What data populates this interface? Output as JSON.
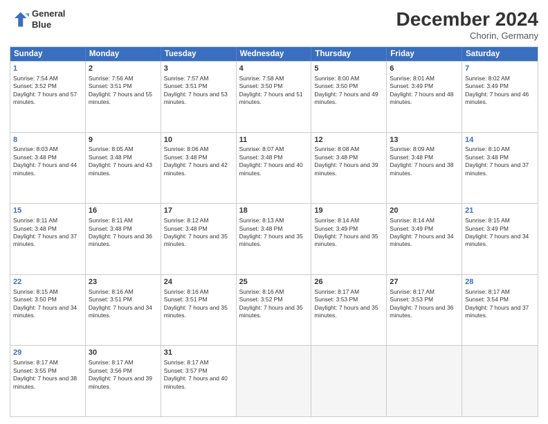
{
  "header": {
    "logo_line1": "General",
    "logo_line2": "Blue",
    "month": "December 2024",
    "location": "Chorin, Germany"
  },
  "days_of_week": [
    "Sunday",
    "Monday",
    "Tuesday",
    "Wednesday",
    "Thursday",
    "Friday",
    "Saturday"
  ],
  "weeks": [
    [
      {
        "day": 1,
        "sunrise": "7:54 AM",
        "sunset": "3:52 PM",
        "daylight": "7 hours and 57 minutes.",
        "dow": "sunday"
      },
      {
        "day": 2,
        "sunrise": "7:56 AM",
        "sunset": "3:51 PM",
        "daylight": "7 hours and 55 minutes.",
        "dow": "monday"
      },
      {
        "day": 3,
        "sunrise": "7:57 AM",
        "sunset": "3:51 PM",
        "daylight": "7 hours and 53 minutes.",
        "dow": "tuesday"
      },
      {
        "day": 4,
        "sunrise": "7:58 AM",
        "sunset": "3:50 PM",
        "daylight": "7 hours and 51 minutes.",
        "dow": "wednesday"
      },
      {
        "day": 5,
        "sunrise": "8:00 AM",
        "sunset": "3:50 PM",
        "daylight": "7 hours and 49 minutes.",
        "dow": "thursday"
      },
      {
        "day": 6,
        "sunrise": "8:01 AM",
        "sunset": "3:49 PM",
        "daylight": "7 hours and 48 minutes.",
        "dow": "friday"
      },
      {
        "day": 7,
        "sunrise": "8:02 AM",
        "sunset": "3:49 PM",
        "daylight": "7 hours and 46 minutes.",
        "dow": "saturday"
      }
    ],
    [
      {
        "day": 8,
        "sunrise": "8:03 AM",
        "sunset": "3:48 PM",
        "daylight": "7 hours and 44 minutes.",
        "dow": "sunday"
      },
      {
        "day": 9,
        "sunrise": "8:05 AM",
        "sunset": "3:48 PM",
        "daylight": "7 hours and 43 minutes.",
        "dow": "monday"
      },
      {
        "day": 10,
        "sunrise": "8:06 AM",
        "sunset": "3:48 PM",
        "daylight": "7 hours and 42 minutes.",
        "dow": "tuesday"
      },
      {
        "day": 11,
        "sunrise": "8:07 AM",
        "sunset": "3:48 PM",
        "daylight": "7 hours and 40 minutes.",
        "dow": "wednesday"
      },
      {
        "day": 12,
        "sunrise": "8:08 AM",
        "sunset": "3:48 PM",
        "daylight": "7 hours and 39 minutes.",
        "dow": "thursday"
      },
      {
        "day": 13,
        "sunrise": "8:09 AM",
        "sunset": "3:48 PM",
        "daylight": "7 hours and 38 minutes.",
        "dow": "friday"
      },
      {
        "day": 14,
        "sunrise": "8:10 AM",
        "sunset": "3:48 PM",
        "daylight": "7 hours and 37 minutes.",
        "dow": "saturday"
      }
    ],
    [
      {
        "day": 15,
        "sunrise": "8:11 AM",
        "sunset": "3:48 PM",
        "daylight": "7 hours and 37 minutes.",
        "dow": "sunday"
      },
      {
        "day": 16,
        "sunrise": "8:11 AM",
        "sunset": "3:48 PM",
        "daylight": "7 hours and 36 minutes.",
        "dow": "monday"
      },
      {
        "day": 17,
        "sunrise": "8:12 AM",
        "sunset": "3:48 PM",
        "daylight": "7 hours and 35 minutes.",
        "dow": "tuesday"
      },
      {
        "day": 18,
        "sunrise": "8:13 AM",
        "sunset": "3:48 PM",
        "daylight": "7 hours and 35 minutes.",
        "dow": "wednesday"
      },
      {
        "day": 19,
        "sunrise": "8:14 AM",
        "sunset": "3:49 PM",
        "daylight": "7 hours and 35 minutes.",
        "dow": "thursday"
      },
      {
        "day": 20,
        "sunrise": "8:14 AM",
        "sunset": "3:49 PM",
        "daylight": "7 hours and 34 minutes.",
        "dow": "friday"
      },
      {
        "day": 21,
        "sunrise": "8:15 AM",
        "sunset": "3:49 PM",
        "daylight": "7 hours and 34 minutes.",
        "dow": "saturday"
      }
    ],
    [
      {
        "day": 22,
        "sunrise": "8:15 AM",
        "sunset": "3:50 PM",
        "daylight": "7 hours and 34 minutes.",
        "dow": "sunday"
      },
      {
        "day": 23,
        "sunrise": "8:16 AM",
        "sunset": "3:51 PM",
        "daylight": "7 hours and 34 minutes.",
        "dow": "monday"
      },
      {
        "day": 24,
        "sunrise": "8:16 AM",
        "sunset": "3:51 PM",
        "daylight": "7 hours and 35 minutes.",
        "dow": "tuesday"
      },
      {
        "day": 25,
        "sunrise": "8:16 AM",
        "sunset": "3:52 PM",
        "daylight": "7 hours and 35 minutes.",
        "dow": "wednesday"
      },
      {
        "day": 26,
        "sunrise": "8:17 AM",
        "sunset": "3:53 PM",
        "daylight": "7 hours and 35 minutes.",
        "dow": "thursday"
      },
      {
        "day": 27,
        "sunrise": "8:17 AM",
        "sunset": "3:53 PM",
        "daylight": "7 hours and 36 minutes.",
        "dow": "friday"
      },
      {
        "day": 28,
        "sunrise": "8:17 AM",
        "sunset": "3:54 PM",
        "daylight": "7 hours and 37 minutes.",
        "dow": "saturday"
      }
    ],
    [
      {
        "day": 29,
        "sunrise": "8:17 AM",
        "sunset": "3:55 PM",
        "daylight": "7 hours and 38 minutes.",
        "dow": "sunday"
      },
      {
        "day": 30,
        "sunrise": "8:17 AM",
        "sunset": "3:56 PM",
        "daylight": "7 hours and 39 minutes.",
        "dow": "monday"
      },
      {
        "day": 31,
        "sunrise": "8:17 AM",
        "sunset": "3:57 PM",
        "daylight": "7 hours and 40 minutes.",
        "dow": "tuesday"
      },
      null,
      null,
      null,
      null
    ]
  ]
}
